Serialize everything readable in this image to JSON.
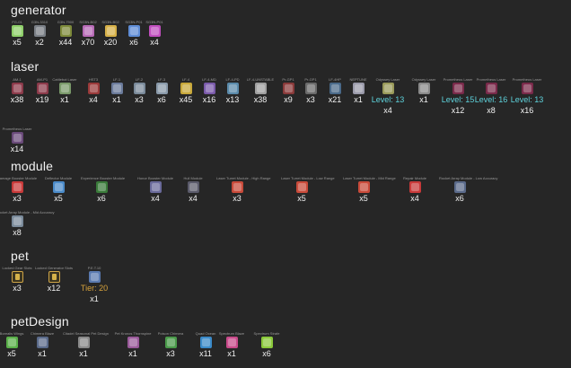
{
  "sections": [
    {
      "title": "generator",
      "items": [
        {
          "name": "FG-01",
          "count": "x5",
          "color": "#8fcf6a"
        },
        {
          "name": "G3N-3310",
          "count": "x2",
          "color": "#7a7f86"
        },
        {
          "name": "G3N-7900",
          "count": "x44",
          "color": "#7d8a3a"
        },
        {
          "name": "SG3N-B02",
          "count": "x70",
          "color": "#b86bb7"
        },
        {
          "name": "SG3N-B02",
          "count": "x20",
          "color": "#d6b048"
        },
        {
          "name": "SG3N-P01",
          "count": "x6",
          "color": "#5f8dd6"
        },
        {
          "name": "SG3N-P01",
          "count": "x4",
          "color": "#c14fbf"
        }
      ]
    },
    {
      "title": "laser",
      "items": [
        {
          "name": "AM-1",
          "count": "x38",
          "color": "#8c3a4a"
        },
        {
          "name": "AM-P1",
          "count": "x19",
          "color": "#8c3a4a"
        },
        {
          "name": "Cattlebot Laser",
          "count": "x1",
          "color": "#7a9a6a"
        },
        {
          "name": "HST3",
          "count": "x4",
          "color": "#9a3a3a"
        },
        {
          "name": "LF-1",
          "count": "x1",
          "color": "#6a7a9a"
        },
        {
          "name": "LF-2",
          "count": "x3",
          "color": "#7a8a9a"
        },
        {
          "name": "LF-3",
          "count": "x6",
          "color": "#8a9aaa"
        },
        {
          "name": "LF-4",
          "count": "x45",
          "color": "#c8a83a"
        },
        {
          "name": "LF-4-MD",
          "count": "x16",
          "color": "#7a5aaa"
        },
        {
          "name": "LF-4-PD",
          "count": "x13",
          "color": "#5a8aaa"
        },
        {
          "name": "LF-4-UNSTABLE",
          "count": "x38",
          "color": "#a0a0a0"
        },
        {
          "name": "Pr-GP1",
          "count": "x9",
          "color": "#8a3a3a"
        },
        {
          "name": "Pr-GP1",
          "count": "x3",
          "color": "#6a6a6a"
        },
        {
          "name": "LF-4HP",
          "count": "x21",
          "color": "#4a6a8a"
        },
        {
          "name": "NEPTUNE",
          "count": "x1",
          "color": "#9a9aaa"
        },
        {
          "name": "Odyssey Laser",
          "level": "Level: 13",
          "count": "x4",
          "color": "#9a9a5a"
        },
        {
          "name": "Odyssey Laser",
          "count": "x1",
          "color": "#8a8a8a"
        },
        {
          "name": "Prometheus Laser",
          "level": "Level: 15",
          "count": "x12",
          "color": "#7a2a4a"
        },
        {
          "name": "Prometheus Laser",
          "level": "Level: 16",
          "count": "x8",
          "color": "#7a2a4a"
        },
        {
          "name": "Prometheus Laser",
          "level": "Level: 13",
          "count": "x16",
          "color": "#7a2a4a"
        },
        {
          "name": "Prometheus Laser",
          "count": "x14",
          "color": "#6a4a7a"
        }
      ]
    },
    {
      "title": "module",
      "items": [
        {
          "name": "Damage Booster Module",
          "count": "x3",
          "color": "#c83a3a"
        },
        {
          "name": "Deflector Module",
          "count": "x5",
          "color": "#4a8ac8"
        },
        {
          "name": "Experience Booster Module",
          "count": "x6",
          "color": "#3a7a3a"
        },
        {
          "name": "Honor Booster Module",
          "count": "x4",
          "color": "#6a6a9a"
        },
        {
          "name": "Hull Module",
          "count": "x4",
          "color": "#5a5a6a"
        },
        {
          "name": "Laser Turret Module - High Range",
          "count": "x3",
          "color": "#c84a3a"
        },
        {
          "name": "Laser Turret Module - Low Range",
          "count": "x5",
          "color": "#c84a3a"
        },
        {
          "name": "Laser Turret Module - Mid Range",
          "count": "x5",
          "color": "#c84a3a"
        },
        {
          "name": "Repair Module",
          "count": "x4",
          "color": "#c83a3a"
        },
        {
          "name": "Rocket Array Module - Low Accuracy",
          "count": "x6",
          "color": "#5a6a8a"
        },
        {
          "name": "Rocket Array Module - Mid Accuracy",
          "count": "x8",
          "color": "#7a8a9a"
        }
      ]
    },
    {
      "title": "pet",
      "items": [
        {
          "name": "Locked Gear Slots",
          "count": "x3",
          "color": "#3a3420",
          "framed": true
        },
        {
          "name": "Locked Generator Slots",
          "count": "x12",
          "color": "#3a3420",
          "framed": true
        },
        {
          "name": "P.E.T.10",
          "tier": "Tier: 20",
          "count": "x1",
          "color": "#5a7ab0"
        }
      ]
    },
    {
      "title": "petDesign",
      "items": [
        {
          "name": "Borealis Wings",
          "count": "x5",
          "color": "#5ab04a"
        },
        {
          "name": "Chimera Blaze",
          "count": "x1",
          "color": "#5a6a8a"
        },
        {
          "name": "Citadel Seasonal Pet Design",
          "count": "x1",
          "color": "#8a8a8a"
        },
        {
          "name": "Pet Kronos Thornspine",
          "count": "x1",
          "color": "#9a5a9a"
        },
        {
          "name": "Poison Chimera",
          "count": "x3",
          "color": "#4a9a4a"
        },
        {
          "name": "Quad Ocean",
          "count": "x11",
          "color": "#3a8ac8"
        },
        {
          "name": "Spectrum Blaze",
          "count": "x1",
          "color": "#c84a8a"
        },
        {
          "name": "Spectrum Strafe",
          "count": "x6",
          "color": "#8ac83a"
        }
      ]
    }
  ]
}
